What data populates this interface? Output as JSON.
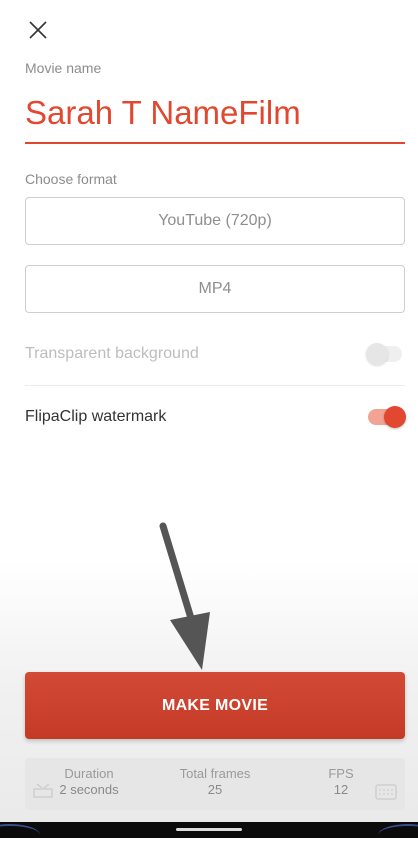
{
  "header": {
    "close_icon": "close-icon"
  },
  "movie": {
    "name_label": "Movie name",
    "name_value": "Sarah T NameFilm"
  },
  "format": {
    "label": "Choose format",
    "resolution": "YouTube (720p)",
    "container": "MP4"
  },
  "options": {
    "transparent_bg": {
      "label": "Transparent background",
      "enabled": false
    },
    "watermark": {
      "label": "FlipaClip watermark",
      "enabled": true
    }
  },
  "actions": {
    "make_movie": "MAKE MOVIE"
  },
  "stats": {
    "duration_label": "Duration",
    "duration_value": "2 seconds",
    "frames_label": "Total frames",
    "frames_value": "25",
    "fps_label": "FPS",
    "fps_value": "12"
  },
  "colors": {
    "accent": "#e2472f",
    "button": "#c94430"
  }
}
